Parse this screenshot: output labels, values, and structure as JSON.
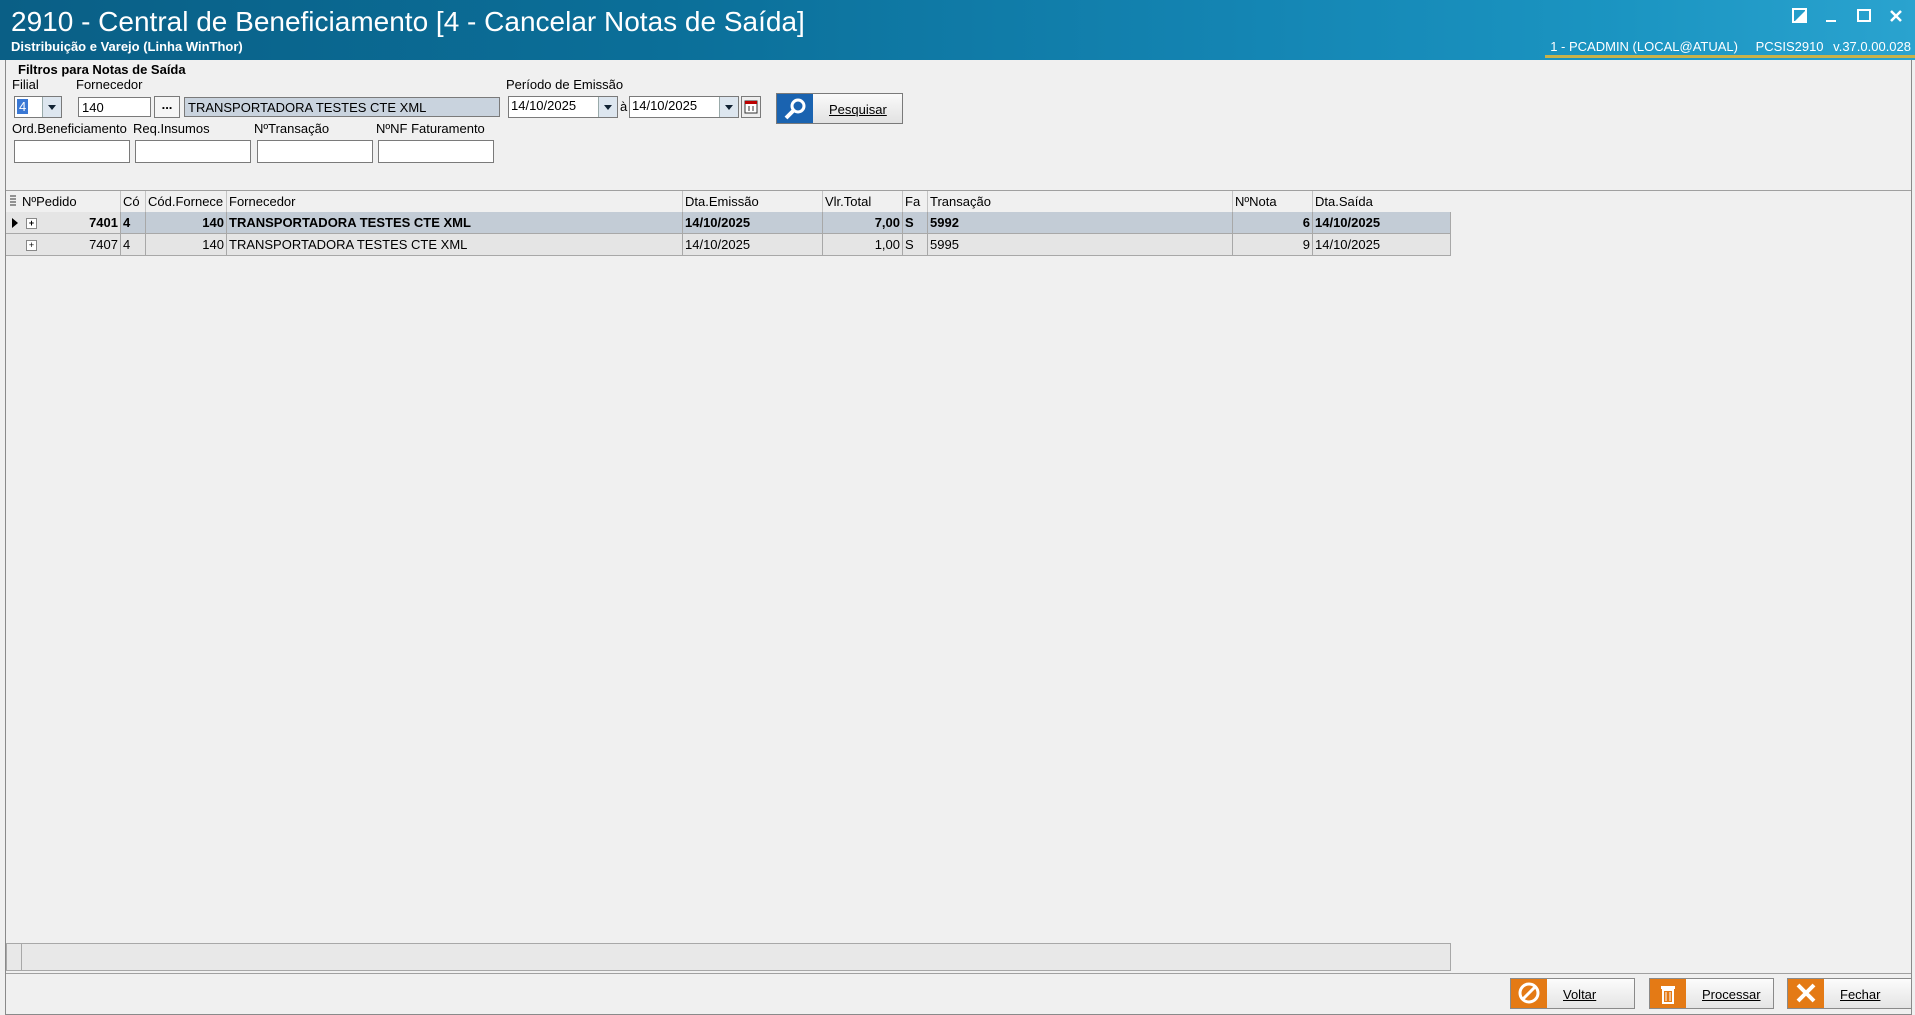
{
  "window": {
    "title": "2910 - Central de Beneficiamento [4 - Cancelar Notas de Saída]",
    "subtitle": "Distribuição e Varejo (Linha WinThor)",
    "user": "1 - PCADMIN (LOCAL@ATUAL)",
    "program": "PCSIS2910",
    "version": "v.37.0.00.028"
  },
  "filters": {
    "group_title": "Filtros para Notas de Saída",
    "filial_label": "Filial",
    "filial_value": "4",
    "fornecedor_label": "Fornecedor",
    "fornecedor_code": "140",
    "fornecedor_lookup": "...",
    "fornecedor_name": "TRANSPORTADORA TESTES CTE XML",
    "periodo_label": "Período de Emissão",
    "data_inicio": "14/10/2025",
    "separator": "à",
    "data_fim": "14/10/2025",
    "ord_benef_label": "Ord.Beneficiamento",
    "req_insumos_label": "Req.Insumos",
    "ntransacao_label": "NºTransação",
    "nnf_label": "NºNF Faturamento",
    "search_label": "Pesquisar"
  },
  "grid": {
    "headers": [
      "NºPedido",
      "Có",
      "Cód.Fornece",
      "Fornecedor",
      "Dta.Emissão",
      "Vlr.Total",
      "Fa",
      "Transação",
      "NºNota",
      "Dta.Saída"
    ],
    "rows": [
      [
        "7401",
        "4",
        "140",
        "TRANSPORTADORA TESTES CTE XML",
        "14/10/2025",
        "7,00",
        "S",
        "5992",
        "6",
        "14/10/2025"
      ],
      [
        "7407",
        "4",
        "140",
        "TRANSPORTADORA TESTES CTE XML",
        "14/10/2025",
        "1,00",
        "S",
        "5995",
        "9",
        "14/10/2025"
      ]
    ]
  },
  "actions": {
    "voltar": "Voltar",
    "processar": "Processar",
    "fechar": "Fechar"
  }
}
